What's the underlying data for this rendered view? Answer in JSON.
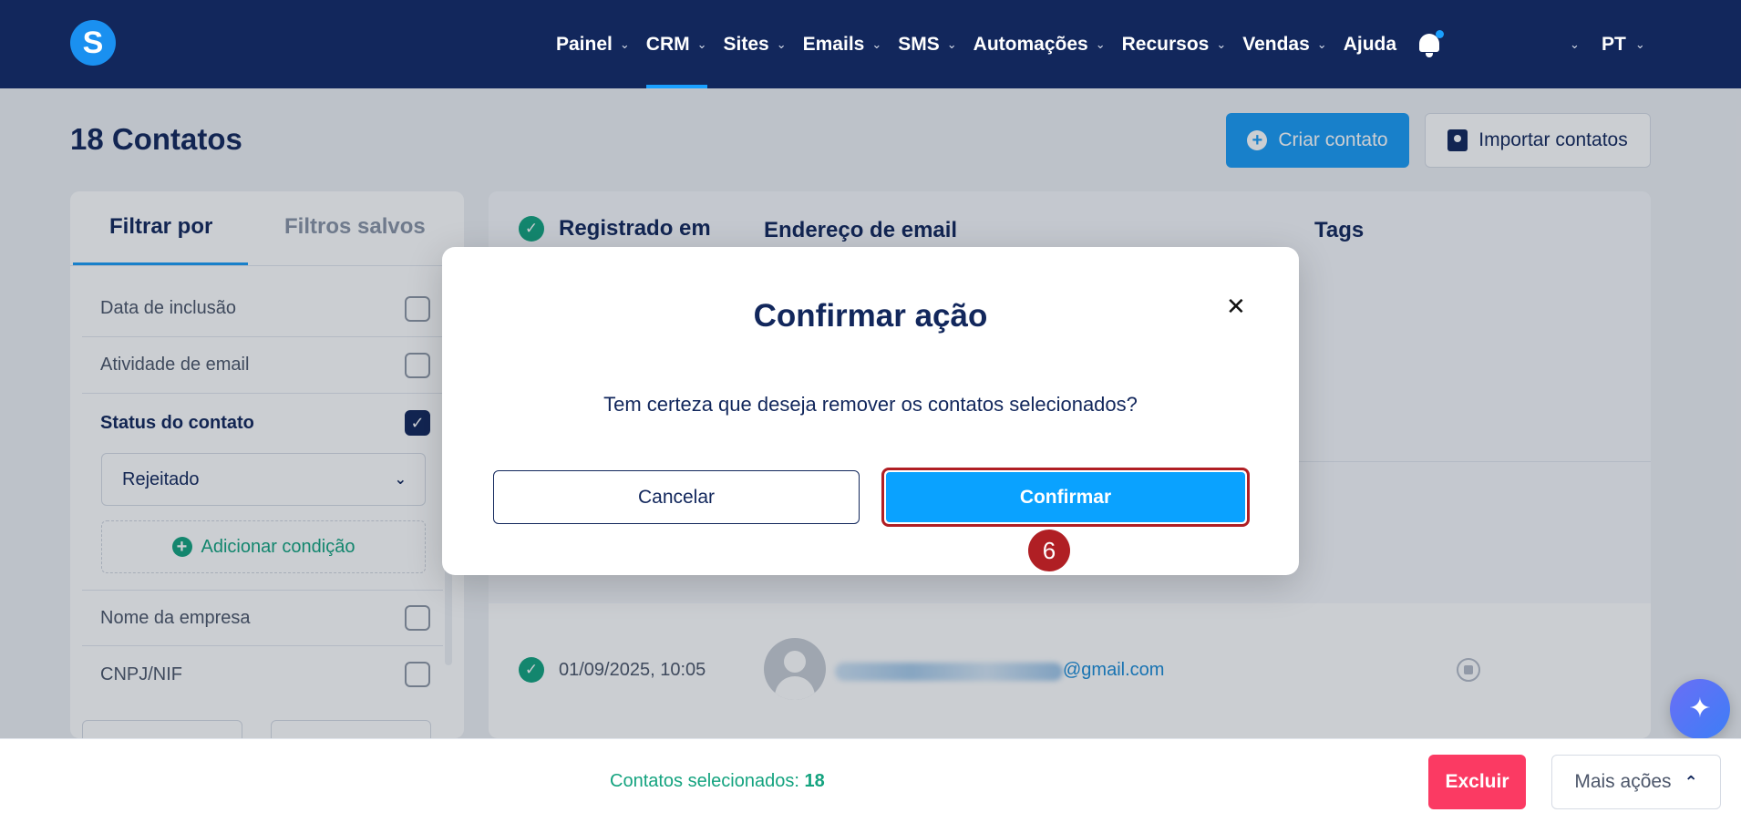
{
  "nav": {
    "logo": "S",
    "items": [
      {
        "label": "Painel",
        "chevron": true,
        "active": false
      },
      {
        "label": "CRM",
        "chevron": true,
        "active": true
      },
      {
        "label": "Sites",
        "chevron": true,
        "active": false
      },
      {
        "label": "Emails",
        "chevron": true,
        "active": false
      },
      {
        "label": "SMS",
        "chevron": true,
        "active": false
      },
      {
        "label": "Automações",
        "chevron": true,
        "active": false
      },
      {
        "label": "Recursos",
        "chevron": true,
        "active": false
      },
      {
        "label": "Vendas",
        "chevron": true,
        "active": false
      },
      {
        "label": "Ajuda",
        "chevron": false,
        "active": false
      }
    ],
    "language": "PT"
  },
  "page": {
    "title": "18 Contatos",
    "create_button": "Criar contato",
    "import_button": "Importar contatos"
  },
  "filters": {
    "tab_active": "Filtrar por",
    "tab_inactive": "Filtros salvos",
    "rows": [
      {
        "label": "Data de inclusão",
        "checked": false
      },
      {
        "label": "Atividade de email",
        "checked": false
      },
      {
        "label": "Status do contato",
        "checked": true
      }
    ],
    "status_select": "Rejeitado",
    "add_condition": "Adicionar condição",
    "rows_below": [
      {
        "label": "Nome da empresa",
        "checked": false
      },
      {
        "label": "CNPJ/NIF",
        "checked": false
      }
    ]
  },
  "table": {
    "col_registered": "Registrado em",
    "col_email": "Endereço de email",
    "col_tags": "Tags",
    "row": {
      "date": "01/09/2025, 10:05",
      "email_domain": "@gmail.com"
    }
  },
  "modal": {
    "title": "Confirmar ação",
    "close": "✕",
    "message": "Tem certeza que deseja remover os contatos selecionados?",
    "cancel": "Cancelar",
    "confirm": "Confirmar",
    "step": "6"
  },
  "bottom": {
    "selected_label": "Contatos selecionados:",
    "selected_count": "18",
    "delete": "Excluir",
    "more": "Mais ações"
  },
  "colors": {
    "nav_bg": "#12275c",
    "primary": "#1a9bf5",
    "confirm": "#0aa2ff",
    "highlight": "#b01f24",
    "success": "#14a37f",
    "danger": "#fb3a63"
  }
}
